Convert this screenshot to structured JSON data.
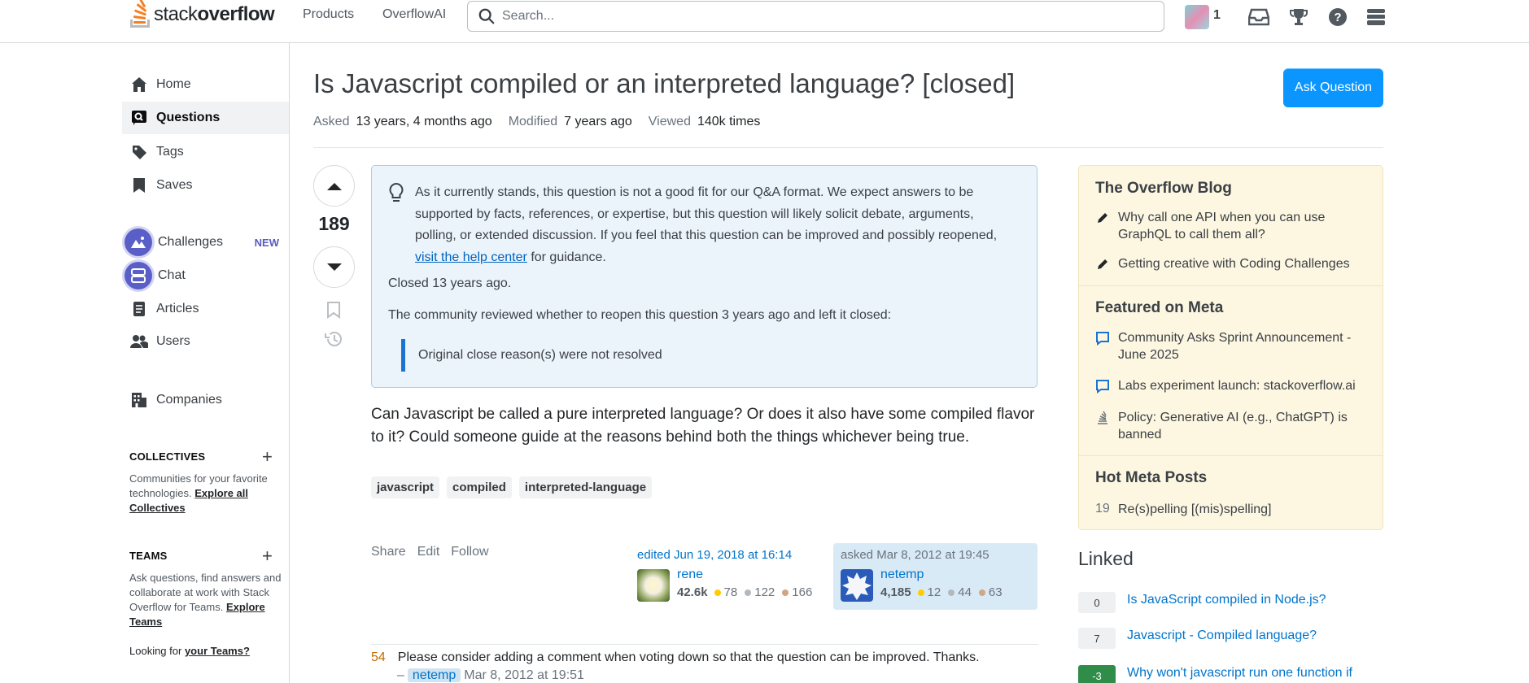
{
  "header": {
    "logo_light": "stack",
    "logo_bold": "overflow",
    "nav": [
      "Products",
      "OverflowAI"
    ],
    "search_placeholder": "Search...",
    "reputation": "1"
  },
  "sidebar": {
    "items": [
      {
        "label": "Home",
        "icon": "home-icon"
      },
      {
        "label": "Questions",
        "icon": "questions-icon",
        "active": true
      },
      {
        "label": "Tags",
        "icon": "tag-icon"
      },
      {
        "label": "Saves",
        "icon": "bookmark-icon"
      },
      {
        "label": "Challenges",
        "icon": "challenges-icon",
        "badge": "NEW"
      },
      {
        "label": "Chat",
        "icon": "chat-icon"
      },
      {
        "label": "Articles",
        "icon": "articles-icon"
      },
      {
        "label": "Users",
        "icon": "users-icon"
      },
      {
        "label": "Companies",
        "icon": "companies-icon"
      }
    ],
    "collectives": {
      "title": "COLLECTIVES",
      "desc": "Communities for your favorite technologies.",
      "link": "Explore all Collectives"
    },
    "teams": {
      "title": "TEAMS",
      "desc": "Ask questions, find answers and collaborate at work with Stack Overflow for Teams.",
      "link": "Explore Teams",
      "looking": "Looking for",
      "looking_link": "your Teams?"
    }
  },
  "question": {
    "title": "Is Javascript compiled or an interpreted language? [closed]",
    "ask_button": "Ask Question",
    "meta": {
      "asked_label": "Asked",
      "asked": "13 years, 4 months ago",
      "modified_label": "Modified",
      "modified": "7 years ago",
      "viewed_label": "Viewed",
      "viewed": "140k times"
    },
    "votes": "189",
    "notice": {
      "text": "As it currently stands, this question is not a good fit for our Q&A format. We expect answers to be supported by facts, references, or expertise, but this question will likely solicit debate, arguments, polling, or extended discussion. If you feel that this question can be improved and possibly reopened,",
      "link": "visit the help center",
      "text_after": "for guidance.",
      "closed": "Closed 13 years ago.",
      "review": "The community reviewed whether to reopen this question 3 years ago and left it closed:",
      "reason": "Original close reason(s) were not resolved"
    },
    "body": "Can Javascript be called a pure interpreted language? Or does it also have some compiled flavor to it? Could someone guide at the reasons behind both the things whichever being true.",
    "tags": [
      "javascript",
      "compiled",
      "interpreted-language"
    ],
    "actions": [
      "Share",
      "Edit",
      "Follow"
    ],
    "editor": {
      "action": "edited Jun 19, 2018 at 16:14",
      "name": "rene",
      "rep": "42.6k",
      "gold": "78",
      "silver": "122",
      "bronze": "166"
    },
    "asker": {
      "action": "asked Mar 8, 2012 at 19:45",
      "name": "netemp",
      "rep": "4,185",
      "gold": "12",
      "silver": "44",
      "bronze": "63"
    },
    "comment": {
      "score": "54",
      "text": "Please consider adding a comment when voting down so that the question can be improved. Thanks.",
      "dash": "–",
      "user": "netemp",
      "time": "Mar 8, 2012 at 19:51"
    }
  },
  "widget": {
    "blog_title": "The Overflow Blog",
    "blog_items": [
      "Why call one API when you can use GraphQL to call them all?",
      "Getting creative with Coding Challenges"
    ],
    "meta_title": "Featured on Meta",
    "meta_items": [
      "Community Asks Sprint Announcement - June 2025",
      "Labs experiment launch: stackoverflow.ai",
      "Policy: Generative AI (e.g., ChatGPT) is banned"
    ],
    "hot_title": "Hot Meta Posts",
    "hot_items": [
      {
        "count": "19",
        "text": "Re(s)pelling [(mis)spelling]"
      }
    ]
  },
  "linked": {
    "title": "Linked",
    "items": [
      {
        "score": "0",
        "text": "Is JavaScript compiled in Node.js?"
      },
      {
        "score": "7",
        "text": "Javascript - Compiled language?"
      },
      {
        "score": "-3",
        "text": "Why won't javascript run one function if"
      }
    ]
  },
  "colors": {
    "accent": "#0a95ff",
    "brand": "#f48024",
    "link": "#0074cc"
  }
}
